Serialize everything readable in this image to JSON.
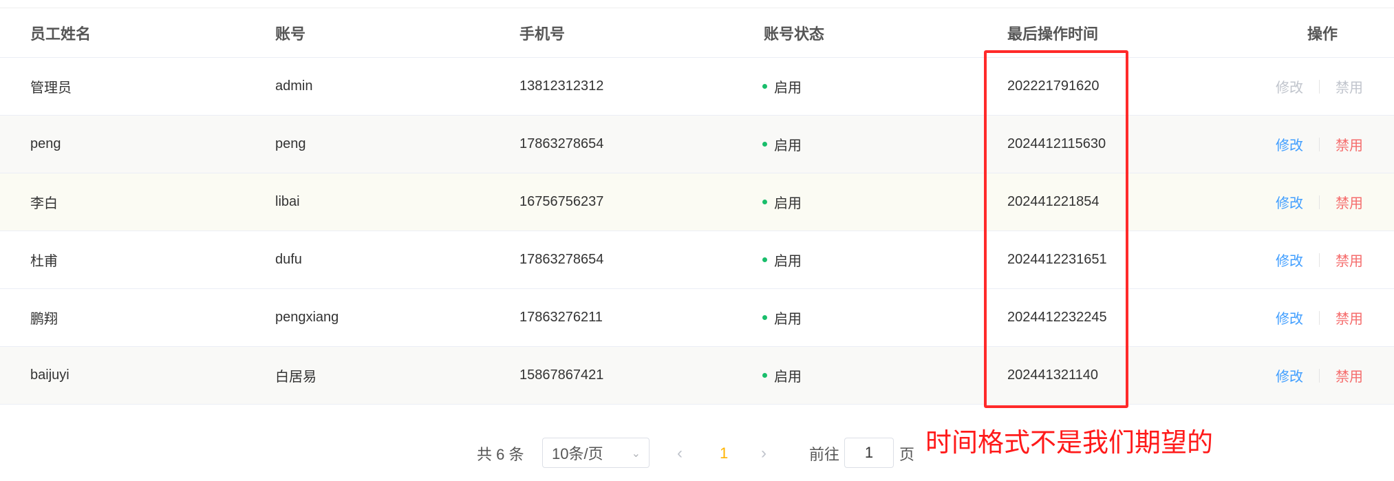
{
  "table": {
    "headers": [
      "员工姓名",
      "账号",
      "手机号",
      "账号状态",
      "最后操作时间",
      "操作"
    ],
    "rows": [
      {
        "name": "管理员",
        "account": "admin",
        "phone": "13812312312",
        "status": "启用",
        "time": "202221791620",
        "edit": "修改",
        "ban": "禁用",
        "disabled": true
      },
      {
        "name": "peng",
        "account": "peng",
        "phone": "17863278654",
        "status": "启用",
        "time": "2024412115630",
        "edit": "修改",
        "ban": "禁用",
        "disabled": false
      },
      {
        "name": "李白",
        "account": "libai",
        "phone": "16756756237",
        "status": "启用",
        "time": "202441221854",
        "edit": "修改",
        "ban": "禁用",
        "disabled": false
      },
      {
        "name": "杜甫",
        "account": "dufu",
        "phone": "17863278654",
        "status": "启用",
        "time": "2024412231651",
        "edit": "修改",
        "ban": "禁用",
        "disabled": false
      },
      {
        "name": "鹏翔",
        "account": "pengxiang",
        "phone": "17863276211",
        "status": "启用",
        "time": "2024412232245",
        "edit": "修改",
        "ban": "禁用",
        "disabled": false
      },
      {
        "name": "baijuyi",
        "account": "白居易",
        "phone": "15867867421",
        "status": "启用",
        "time": "202441321140",
        "edit": "修改",
        "ban": "禁用",
        "disabled": false
      }
    ]
  },
  "pagination": {
    "total": "共 6 条",
    "page_size": "10条/页",
    "prev_icon": "chevron-left-icon",
    "next_icon": "chevron-right-icon",
    "current_page": "1",
    "goto_label": "前往",
    "goto_value": "1",
    "page_suffix": "页"
  },
  "annotation": {
    "text": "时间格式不是我们期望的",
    "color": "#ff1a1a"
  },
  "colors": {
    "status_dot": "#19be6b",
    "edit_link": "#409eff",
    "ban_link": "#f56c6c",
    "current_page": "#ffb400"
  }
}
